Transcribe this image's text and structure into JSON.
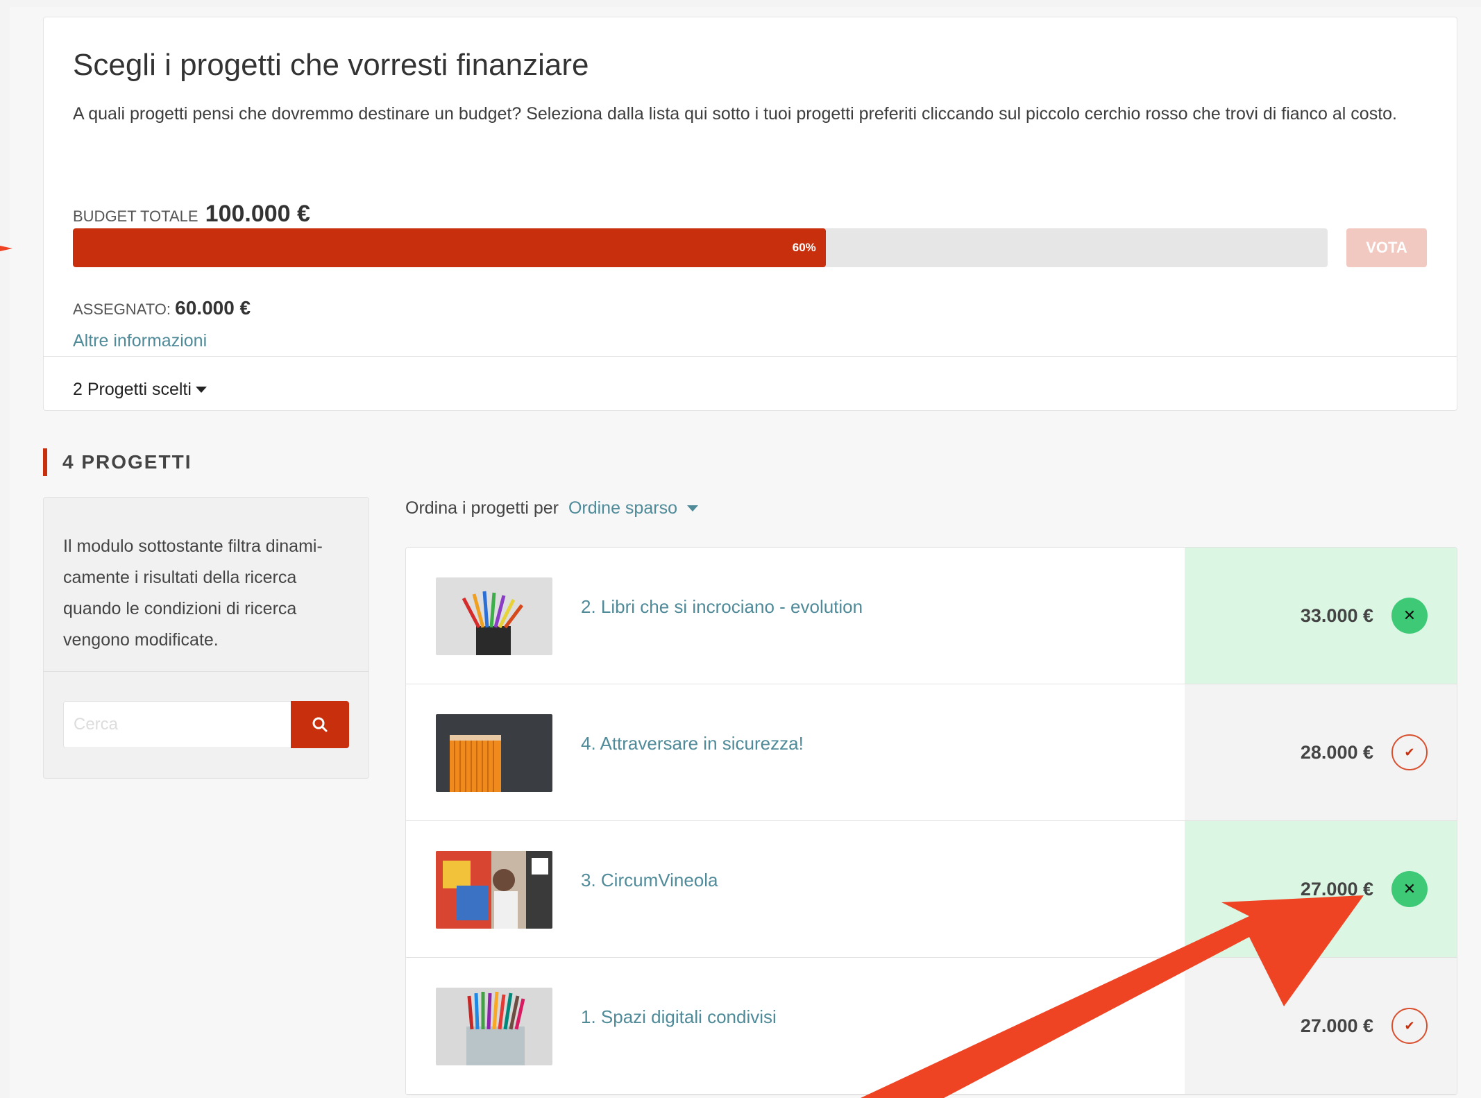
{
  "budget": {
    "title": "Scegli i progetti che vorresti finanziare",
    "description": "A quali progetti pensi che dovremmo destinare un budget? Seleziona dalla lista qui sotto i tuoi progetti preferiti cliccando sul piccolo cerchio rosso che trovi di fianco al costo.",
    "total_label": "Budget totale",
    "total_value": "100.000 €",
    "progress_percent": 60,
    "progress_label": "60%",
    "vote_label": "Vota",
    "assigned_label": "Assegnato:",
    "assigned_value": "60.000 €",
    "more_info": "Altre informazioni",
    "chosen_label": "2 Progetti scelti"
  },
  "section": {
    "heading": "4 PROGETTI"
  },
  "filter": {
    "text": "Il modulo sottostante filtra dinami-camente i risultati della ricerca quando le condizioni di ricerca vengono modificate.",
    "search_placeholder": "Cerca"
  },
  "sort": {
    "label": "Ordina i progetti per",
    "value": "Ordine sparso"
  },
  "projects": [
    {
      "title": "2. Libri che si incrociano - evolution",
      "cost": "33.000 €",
      "selected": true,
      "button_icon": "close-icon"
    },
    {
      "title": "4. Attraversare in sicurezza!",
      "cost": "28.000 €",
      "selected": false,
      "button_icon": "check-icon"
    },
    {
      "title": "3. CircumVineola",
      "cost": "27.000 €",
      "selected": true,
      "button_icon": "close-icon"
    },
    {
      "title": "1. Spazi digitali condivisi",
      "cost": "27.000 €",
      "selected": false,
      "button_icon": "check-icon"
    }
  ],
  "colors": {
    "accent": "#c8300d",
    "link": "#4f8a99",
    "selected_bg": "#dcf6e4",
    "selected_button": "#3ec976",
    "annotation_arrow": "#ef4423"
  }
}
